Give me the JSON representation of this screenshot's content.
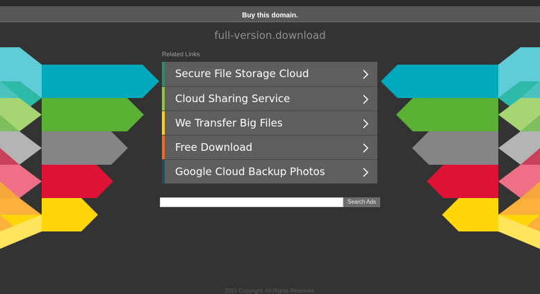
{
  "topbar": {
    "buy_label": "Buy this domain."
  },
  "site": {
    "domain": "full-version.download"
  },
  "related": {
    "heading": "Related Links",
    "items": [
      {
        "label": "Secure File Storage Cloud",
        "accent": "#2e8b6e"
      },
      {
        "label": "Cloud Sharing Service",
        "accent": "#8dc63f"
      },
      {
        "label": "We Transfer Big Files",
        "accent": "#f7d117"
      },
      {
        "label": "Free Download",
        "accent": "#ee6a1d"
      },
      {
        "label": "Google Cloud Backup Photos",
        "accent": "#1d4e58"
      }
    ]
  },
  "search": {
    "value": "",
    "button_label": "Search Ads"
  },
  "footer": {
    "text": "2021 Copyright. All Rights Reserved."
  },
  "icons": {
    "chevron": "chevron-right-icon"
  },
  "colors": {
    "background": "#333333",
    "buy_bar": "#575757",
    "link_row": "#5e5e5e",
    "arrow_stripes": [
      "#00aabc",
      "#5bb134",
      "#858585",
      "#de1234",
      "#ffd60a"
    ]
  }
}
